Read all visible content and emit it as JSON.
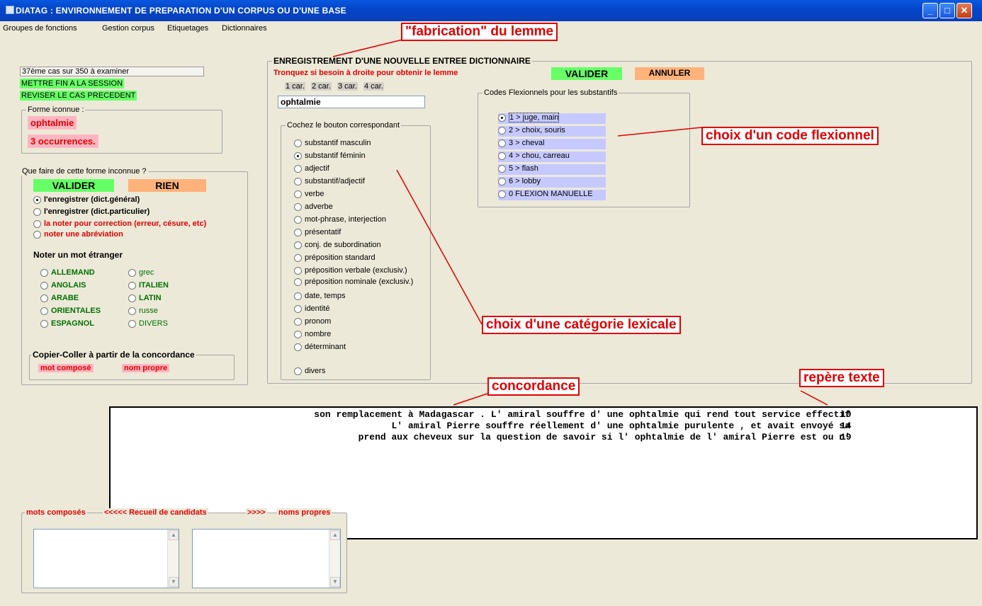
{
  "window": {
    "title": "DIATAG : ENVIRONNEMENT DE PREPARATION D'UN CORPUS OU D'UNE BASE"
  },
  "menu": [
    "Groupes de fonctions",
    "Gestion corpus",
    "Etiquetages",
    "Dictionnaires"
  ],
  "left": {
    "case_status": "37ème cas sur 350 à examiner",
    "end_session": "METTRE FIN A LA SESSION",
    "review_prev": "REVISER LE CAS PRECEDENT",
    "form_group_label": "Forme iconnue :",
    "form_word": "ophtalmie",
    "occurrences": "3 occurrences.",
    "action_group_label": "Que faire de cette forme inconnue ?",
    "valider": "VALIDER",
    "rien": "RIEN",
    "options": [
      "l'enregistrer (dict.général)",
      "l'enregistrer (dict.particulier)",
      "la noter pour correction (erreur, césure, etc)",
      "noter une abréviation"
    ],
    "foreign_title": "Noter un mot étranger",
    "languages_col1": [
      "ALLEMAND",
      "ANGLAIS",
      "ARABE",
      "ORIENTALES",
      "ESPAGNOL"
    ],
    "languages_col2": [
      "grec",
      "ITALIEN",
      "LATIN",
      "russe",
      "DIVERS"
    ],
    "copy_group_label": "Copier-Coller à partir de la concordance",
    "mot_compose": "mot composé",
    "nom_propre": "nom propre"
  },
  "entry": {
    "group_label": "ENREGISTREMENT D'UNE NOUVELLE ENTREE DICTIONNAIRE",
    "instruction": "Tronquez si besoin à droite pour obtenir le lemme",
    "valider": "VALIDER",
    "annuler": "ANNULER",
    "trunc_buttons": [
      "1 car.",
      "2 car.",
      "3 car.",
      "4 car."
    ],
    "lemma_value": "ophtalmie",
    "category_group_label": "Cochez le bouton correspondant",
    "categories": [
      "substantif masculin",
      "substantif féminin",
      "adjectif",
      "substantif/adjectif",
      "verbe",
      "adverbe",
      "mot-phrase, interjection",
      "présentatif",
      "conj. de subordination",
      "préposition standard",
      "préposition verbale (exclusiv.)",
      "préposition nominale (exclusiv.)",
      "date, temps",
      "identité",
      "pronom",
      "nombre",
      "déterminant",
      "divers"
    ],
    "flex_group_label": "Codes Flexionnels pour les substantifs",
    "flex_codes": [
      "1 > juge, main",
      "2 > choix, souris",
      "3 > cheval",
      "4 > chou, carreau",
      "5 > flash",
      "6 > lobby",
      "0   FLEXION MANUELLE"
    ]
  },
  "annotations": {
    "lemme": "\"fabrication\" du lemme",
    "flexion": "choix d'un code flexionnel",
    "categorie": "choix d'une catégorie lexicale",
    "concordance": "concordance",
    "repere": "repère texte"
  },
  "concordance": [
    {
      "text": "son remplacement à Madagascar . L' amiral souffre d' une ophtalmie qui rend tout service effectif",
      "ref": "10"
    },
    {
      "text": "L' amiral Pierre souffre réellement d' une ophtalmie purulente , et avait envoyé sa",
      "ref": "14"
    },
    {
      "text": "prend aux cheveux sur la question de savoir si l' ophtalmie de l' amiral Pierre est ou n'",
      "ref": "19"
    }
  ],
  "candidates": {
    "left_label": "mots composés",
    "middle_label": "<<<<<  Recueil de candidats",
    "right_arrows": ">>>>",
    "right_label": "noms propres"
  },
  "colors": {
    "accent_red": "#e00000",
    "valider_green": "#66ff66",
    "annuler_orange": "#ffb27a",
    "flex_blue": "#c6c9ff"
  }
}
